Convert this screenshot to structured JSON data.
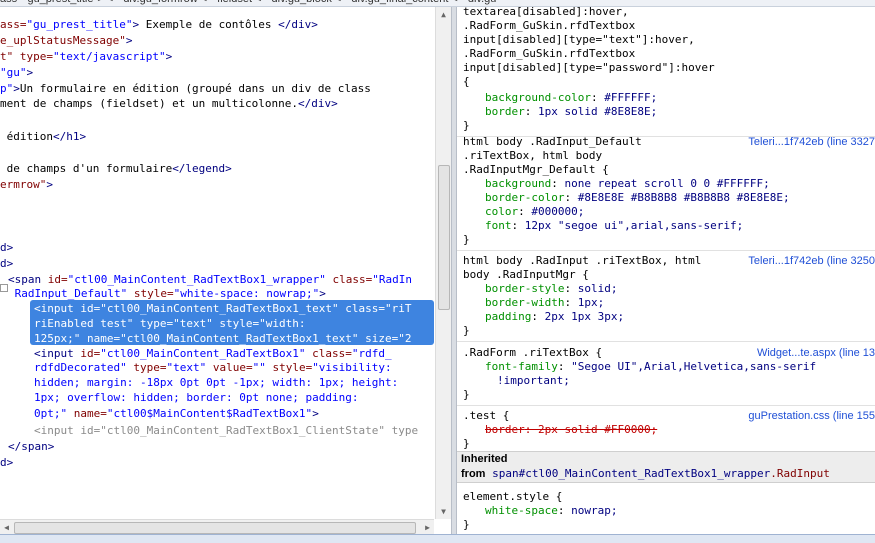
{
  "breadcrumb": {
    "items": [
      "ass=\"gu_prest_title\">",
      "div.gu_formrow",
      "fieldset",
      "div.gu_block",
      "div.gu_final_content",
      "div.gu"
    ]
  },
  "html_panel": {
    "lines": [
      {
        "parts": [
          [
            "attr",
            "ass="
          ],
          [
            "val",
            "\"gu_prest_title\""
          ],
          [
            "tag",
            ">"
          ],
          [
            "txt",
            " Exemple de contôles "
          ],
          [
            "tag",
            "</div>"
          ]
        ]
      },
      {
        "parts": [
          [
            "attr",
            "e_uplStatusMessage\""
          ],
          [
            "tag",
            ">"
          ]
        ]
      },
      {
        "parts": [
          [
            "attr",
            "t\" "
          ],
          [
            "attr",
            "type="
          ],
          [
            "val",
            "\"text/javascript\""
          ],
          [
            "tag",
            ">"
          ]
        ]
      },
      {
        "parts": [
          [
            "val",
            "\"gu\""
          ],
          [
            "tag",
            ">"
          ]
        ]
      },
      {
        "parts": [
          [
            "val",
            "p\""
          ],
          [
            "tag",
            ">"
          ],
          [
            "txt",
            "Un formulaire en édition (groupé dans un div de class"
          ]
        ]
      },
      {
        "parts": [
          [
            "txt",
            "ment de champs (fieldset) et un multicolonne."
          ],
          [
            "tag",
            "</div>"
          ]
        ]
      },
      {
        "parts": [
          [
            "txt",
            " "
          ]
        ]
      },
      {
        "parts": [
          [
            "txt",
            " édition"
          ],
          [
            "tag",
            "</h1>"
          ]
        ]
      },
      {
        "parts": [
          [
            "txt",
            " "
          ]
        ]
      },
      {
        "parts": [
          [
            "txt",
            " de champs d'un formulaire"
          ],
          [
            "tag",
            "</legend>"
          ]
        ]
      },
      {
        "parts": [
          [
            "attr",
            "ermrow\""
          ],
          [
            "tag",
            ">"
          ]
        ]
      },
      {
        "parts": [
          [
            "txt",
            " "
          ]
        ]
      },
      {
        "parts": [
          [
            "txt",
            " "
          ]
        ]
      },
      {
        "parts": [
          [
            "txt",
            " "
          ]
        ]
      },
      {
        "parts": [
          [
            "tag",
            "d>"
          ]
        ]
      },
      {
        "parts": [
          [
            "tag",
            "d>"
          ]
        ]
      },
      {
        "parts": [
          [
            "tag",
            "<span "
          ],
          [
            "attr",
            "id="
          ],
          [
            "val",
            "\"ctl00_MainContent_RadTextBox1_wrapper\""
          ],
          [
            "attr",
            " class="
          ],
          [
            "val",
            "\"RadIn"
          ]
        ]
      },
      {
        "parts": [
          [
            "val",
            " RadInput_Default\""
          ],
          [
            "attr",
            " style="
          ],
          [
            "val",
            "\"white-space: nowrap;\""
          ],
          [
            "tag",
            ">"
          ]
        ]
      },
      {
        "sel": true,
        "parts": [
          [
            "sel",
            "<input id=\"ctl00_MainContent_RadTextBox1_text\" class=\"riT"
          ]
        ]
      },
      {
        "sel": true,
        "parts": [
          [
            "sel",
            "riEnabled test\" type=\"text\" style=\"width:"
          ]
        ]
      },
      {
        "sel": true,
        "parts": [
          [
            "sel",
            "125px;\" name=\"ctl00_MainContent_RadTextBox1_text\" size=\"2"
          ]
        ]
      },
      {
        "parts": [
          [
            "tag",
            "<input "
          ],
          [
            "attr",
            "id="
          ],
          [
            "val",
            "\"ctl00_MainContent_RadTextBox1\""
          ],
          [
            "attr",
            " class="
          ],
          [
            "val",
            "\"rdfd_"
          ]
        ]
      },
      {
        "parts": [
          [
            "val",
            "rdfdDecorated\""
          ],
          [
            "attr",
            " type="
          ],
          [
            "val",
            "\"text\""
          ],
          [
            "attr",
            " value="
          ],
          [
            "val",
            "\"\""
          ],
          [
            "attr",
            " style="
          ],
          [
            "val",
            "\"visibility:"
          ]
        ]
      },
      {
        "parts": [
          [
            "val",
            "hidden; margin: -18px 0pt 0pt -1px; width: 1px; height:"
          ]
        ]
      },
      {
        "parts": [
          [
            "val",
            "1px; overflow: hidden; border: 0pt none; padding:"
          ]
        ]
      },
      {
        "parts": [
          [
            "val",
            "0pt;\""
          ],
          [
            "attr",
            " name="
          ],
          [
            "val",
            "\"ctl00$MainContent$RadTextBox1\""
          ],
          [
            "tag",
            ">"
          ]
        ]
      },
      {
        "parts": [
          [
            "muted",
            "<input id=\"ctl00_MainContent_RadTextBox1_ClientState\" type"
          ]
        ]
      },
      {
        "parts": [
          [
            "tag",
            "</span>"
          ]
        ]
      },
      {
        "parts": [
          [
            "tag",
            "d>"
          ]
        ]
      }
    ]
  },
  "style_panel": {
    "rules": [
      {
        "kind": "sel",
        "text": "textarea[disabled]:hover,"
      },
      {
        "kind": "sel",
        "text": ".RadForm_GuSkin.rfdTextbox"
      },
      {
        "kind": "sel",
        "text": "input[disabled][type=\"text\"]:hover,"
      },
      {
        "kind": "sel",
        "text": ".RadForm_GuSkin.rfdTextbox"
      },
      {
        "kind": "sel",
        "text": "input[disabled][type=\"password\"]:hover"
      },
      {
        "kind": "sel",
        "text": "{"
      },
      {
        "kind": "prop",
        "name": "background-color",
        "value": "#FFFFFF;"
      },
      {
        "kind": "prop",
        "name": "border",
        "value": "1px solid #8E8E8E;"
      },
      {
        "kind": "sel",
        "text": "}"
      },
      {
        "kind": "sel",
        "text": "html body .RadInput_Default",
        "src": "Teleri...1f742eb (line 3327"
      },
      {
        "kind": "sel",
        "text": ".riTextBox, html body"
      },
      {
        "kind": "sel",
        "text": ".RadInputMgr_Default {"
      },
      {
        "kind": "prop",
        "name": "background",
        "value": "none repeat scroll 0 0 #FFFFFF;"
      },
      {
        "kind": "prop",
        "name": "border-color",
        "value": "#8E8E8E #B8B8B8 #B8B8B8 #8E8E8E;"
      },
      {
        "kind": "prop",
        "name": "color",
        "value": "#000000;"
      },
      {
        "kind": "prop",
        "name": "font",
        "value": "12px \"segoe ui\",arial,sans-serif;"
      },
      {
        "kind": "sel",
        "text": "}"
      },
      {
        "kind": "sel",
        "text": "html body .RadInput .riTextBox, html",
        "src": "Teleri...1f742eb (line 3250"
      },
      {
        "kind": "sel",
        "text": "body .RadInputMgr {"
      },
      {
        "kind": "prop",
        "name": "border-style",
        "value": "solid;"
      },
      {
        "kind": "prop",
        "name": "border-width",
        "value": "1px;"
      },
      {
        "kind": "prop",
        "name": "padding",
        "value": "2px 1px 3px;"
      },
      {
        "kind": "sel",
        "text": "}"
      },
      {
        "kind": "sel",
        "text": ".RadForm .riTextBox {",
        "src": "Widget...te.aspx (line 13"
      },
      {
        "kind": "prop",
        "name": "font-family",
        "value": "\"Segoe UI\",Arial,Helvetica,sans-serif"
      },
      {
        "kind": "cont",
        "text": "!important;"
      },
      {
        "kind": "sel",
        "text": "}"
      },
      {
        "kind": "sel",
        "text": ".test {",
        "src": "guPrestation.css (line 155"
      },
      {
        "kind": "prop",
        "name": "border",
        "value": "2px solid #FF0000;",
        "struck": true
      },
      {
        "kind": "sel",
        "text": "}"
      }
    ],
    "inherited": {
      "title": "Inherited",
      "from_label": "from",
      "selector_tag": "span",
      "selector_id": "#ctl00_MainContent_RadTextBox1_wrapper",
      "selector_class": ".RadInput"
    },
    "element_style": {
      "selector": "element.style {",
      "prop_name": "white-space",
      "prop_value": "nowrap;",
      "close": "}"
    }
  }
}
